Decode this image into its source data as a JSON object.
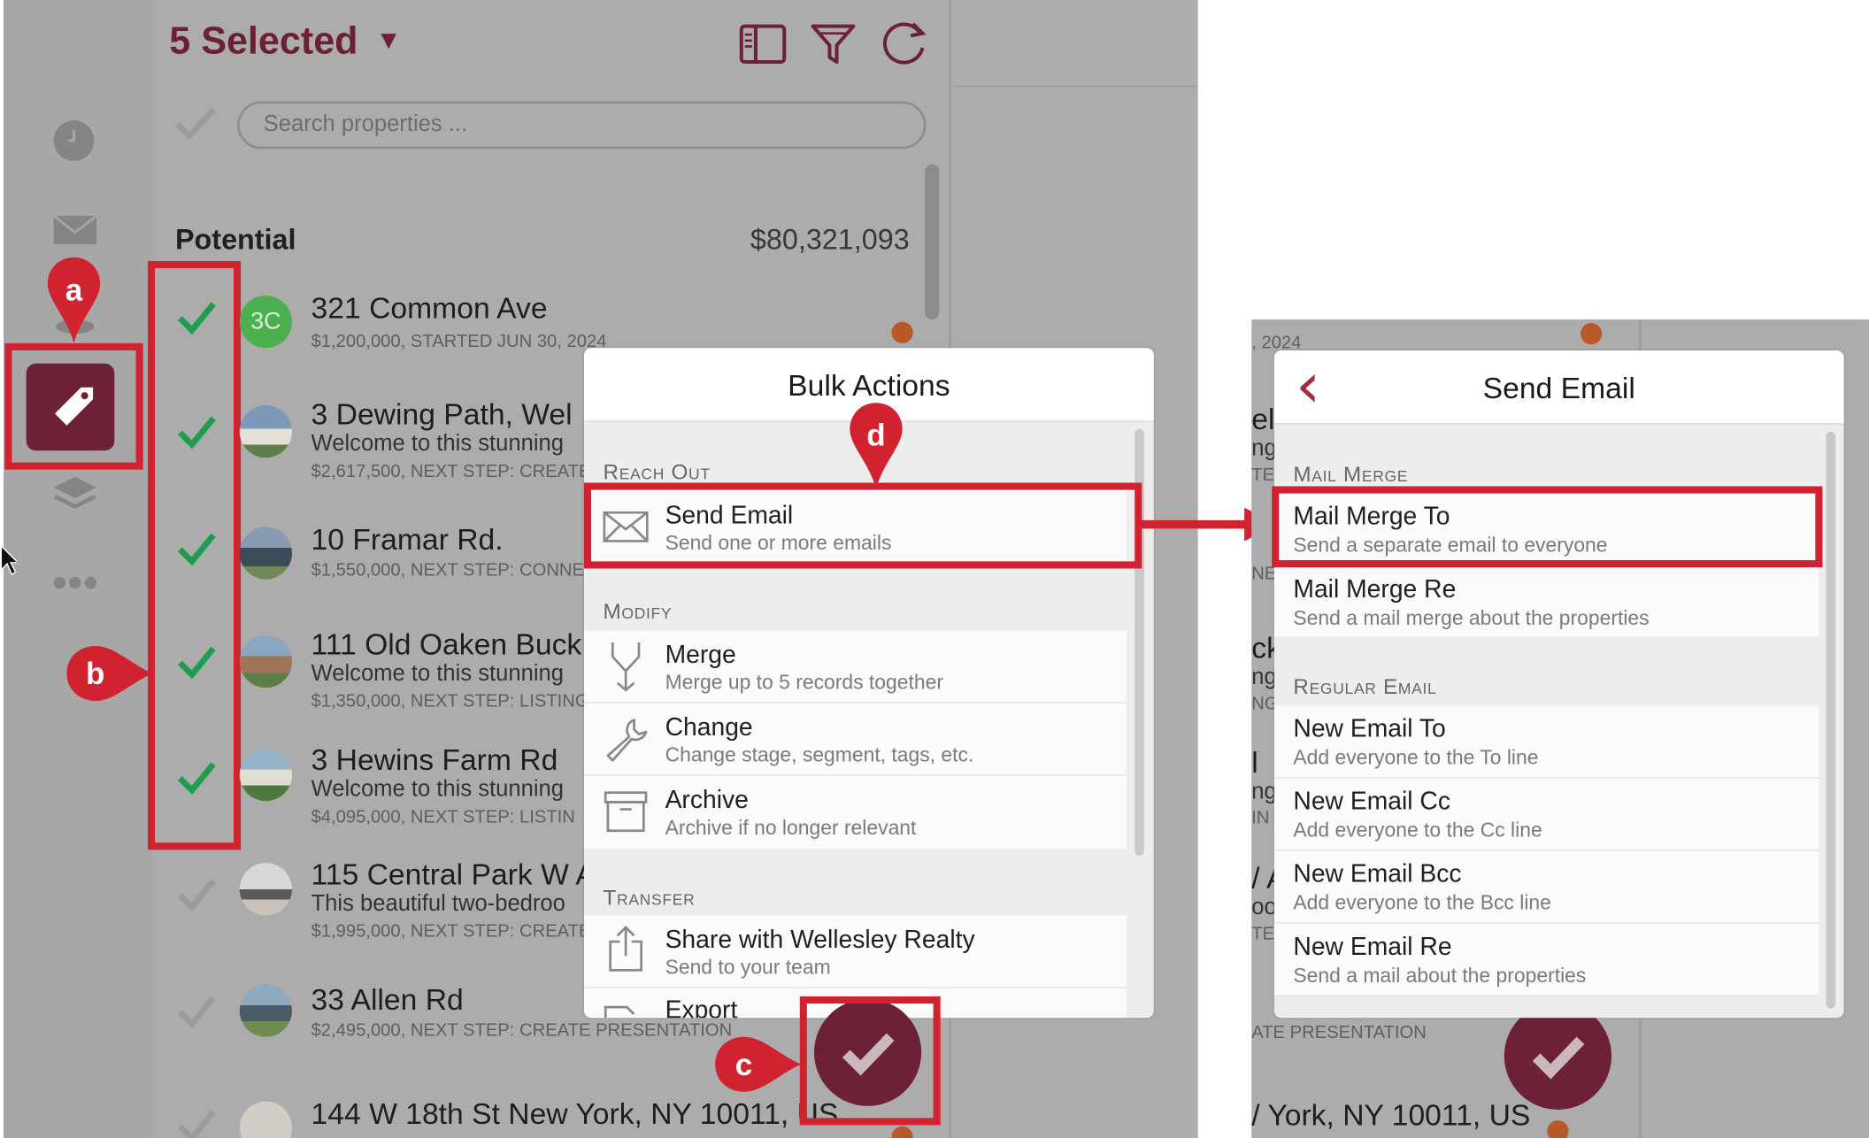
{
  "header": {
    "selected_label": "5 Selected",
    "dropdown_glyph": "▼"
  },
  "search": {
    "placeholder": "Search properties ..."
  },
  "section": {
    "title": "Potential",
    "total": "$80,321,093"
  },
  "avatar_initials": "3C",
  "rows": [
    {
      "title": "321 Common Ave",
      "meta": "$1,200,000, STARTED JUN 30, 2024",
      "checked": true
    },
    {
      "title": "3 Dewing Path, Wel",
      "desc": "Welcome to this stunning",
      "meta": "$2,617,500, NEXT STEP: CREATE",
      "checked": true
    },
    {
      "title": "10 Framar Rd.",
      "meta": "$1,550,000, NEXT STEP: CONNE",
      "checked": true
    },
    {
      "title": "111 Old Oaken Buck",
      "desc": "Welcome to this stunning",
      "meta": "$1,350,000, NEXT STEP: LISTING",
      "checked": true
    },
    {
      "title": "3 Hewins Farm Rd",
      "desc": "Welcome to this stunning",
      "meta": "$4,095,000, NEXT STEP: LISTIN",
      "checked": true
    },
    {
      "title": "115 Central Park W A",
      "desc": "This beautiful two-bedroo",
      "meta": "$1,995,000, NEXT STEP: CREATE",
      "checked": false
    },
    {
      "title": "33 Allen Rd",
      "meta": "$2,495,000, NEXT STEP: CREATE PRESENTATION",
      "checked": false
    },
    {
      "title": "144 W 18th St New York, NY 10011, US",
      "checked": false
    }
  ],
  "annotations": {
    "a": "a",
    "b": "b",
    "c": "c",
    "d": "d"
  },
  "bulk_actions": {
    "title": "Bulk Actions",
    "groups": [
      {
        "label": "Reach Out",
        "items": [
          {
            "title": "Send Email",
            "subtitle": "Send one or more emails",
            "icon": "envelope-icon"
          }
        ]
      },
      {
        "label": "Modify",
        "items": [
          {
            "title": "Merge",
            "subtitle": "Merge up to 5 records together",
            "icon": "merge-icon"
          },
          {
            "title": "Change",
            "subtitle": "Change stage, segment, tags, etc.",
            "icon": "wrench-icon"
          },
          {
            "title": "Archive",
            "subtitle": "Archive if no longer relevant",
            "icon": "archive-icon"
          }
        ]
      },
      {
        "label": "Transfer",
        "items": [
          {
            "title": "Share with Wellesley Realty",
            "subtitle": "Send to your team",
            "icon": "share-icon"
          },
          {
            "title": "Export",
            "icon": "export-icon"
          }
        ]
      }
    ]
  },
  "right_fragments": {
    "top_meta": ", 2024",
    "frag_el": "el",
    "frag_ng": "ng",
    "frag_te": "TE",
    "frag_ne": "NE",
    "frag_ck": "ck",
    "frag_ng2": "ng",
    "frag_ng3": "NG",
    "frag_bar": "l",
    "frag_ng4": "ng",
    "frag_in": "IN",
    "frag_a": "/ A",
    "frag_oo": "oo",
    "frag_te2": "TE",
    "bottom_meta": "ATE PRESENTATION",
    "bottom_addr": "/ York, NY 10011, US"
  },
  "send_email": {
    "title": "Send Email",
    "back_glyph": "‹",
    "groups": [
      {
        "label": "Mail Merge",
        "items": [
          {
            "title": "Mail Merge To",
            "subtitle": "Send a separate email to everyone"
          },
          {
            "title": "Mail Merge Re",
            "subtitle": "Send a mail merge about the properties"
          }
        ]
      },
      {
        "label": "Regular Email",
        "items": [
          {
            "title": "New Email To",
            "subtitle": "Add everyone to the To line"
          },
          {
            "title": "New Email Cc",
            "subtitle": "Add everyone to the Cc line"
          },
          {
            "title": "New Email Bcc",
            "subtitle": "Add everyone to the Bcc line"
          },
          {
            "title": "New Email Re",
            "subtitle": "Send a mail about the properties"
          }
        ]
      }
    ]
  },
  "colors": {
    "brand": "#6d2137",
    "check_green": "#1e9d4e",
    "annotation_red": "#d1232f",
    "status_orange": "#b8592a"
  }
}
